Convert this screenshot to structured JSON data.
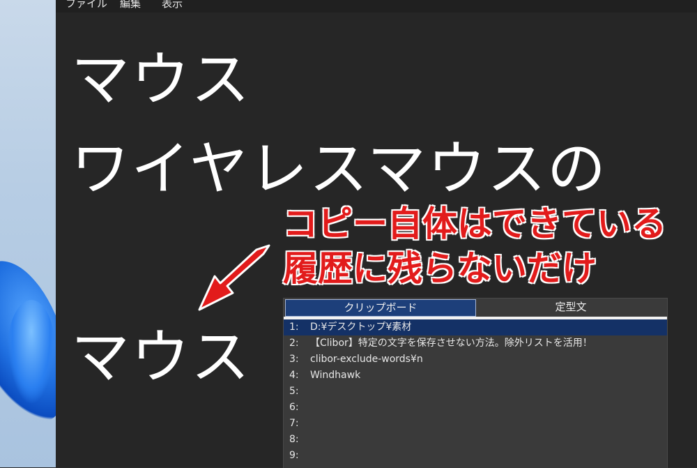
{
  "menu": {
    "file": "ファイル",
    "edit": "編集",
    "view": "表示"
  },
  "editor_lines": [
    "マウス",
    "ワイヤレスマウスの",
    "マウス"
  ],
  "annotation": {
    "line1": "コピー自体はできている",
    "line2": "履歴に残らないだけ",
    "color": "#e21b1b"
  },
  "clipboard": {
    "tabs": [
      "クリップボード",
      "定型文"
    ],
    "active_tab": 0,
    "items": [
      {
        "num": "1:",
        "text": "D:¥デスクトップ¥素材"
      },
      {
        "num": "2:",
        "text": "【Clibor】特定の文字を保存させない方法。除外リストを活用！"
      },
      {
        "num": "3:",
        "text": "clibor-exclude-words¥n"
      },
      {
        "num": "4:",
        "text": "Windhawk"
      },
      {
        "num": "5:",
        "text": ""
      },
      {
        "num": "6:",
        "text": ""
      },
      {
        "num": "7:",
        "text": ""
      },
      {
        "num": "8:",
        "text": ""
      },
      {
        "num": "9:",
        "text": ""
      }
    ],
    "selected_index": 0,
    "selection_color": "#143166"
  }
}
